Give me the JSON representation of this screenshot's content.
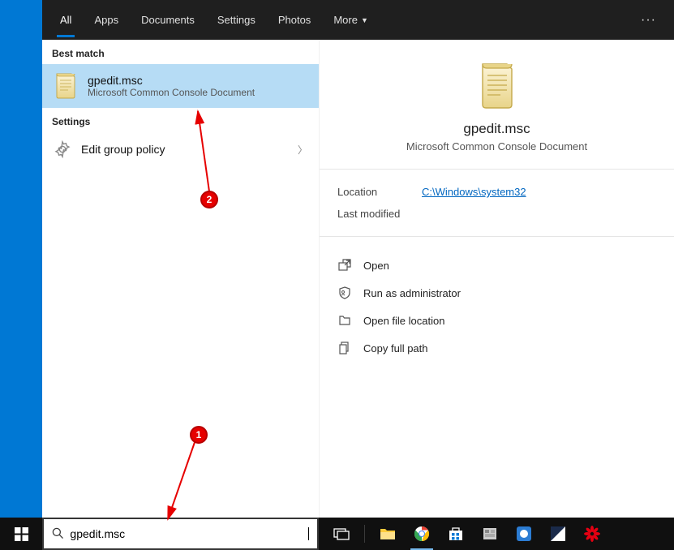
{
  "tabs": {
    "all": "All",
    "apps": "Apps",
    "documents": "Documents",
    "settings": "Settings",
    "photos": "Photos",
    "more": "More"
  },
  "sections": {
    "best_match": "Best match",
    "settings": "Settings"
  },
  "best_match": {
    "title": "gpedit.msc",
    "subtitle": "Microsoft Common Console Document"
  },
  "settings_results": {
    "edit_group_policy": "Edit group policy"
  },
  "preview": {
    "name": "gpedit.msc",
    "type": "Microsoft Common Console Document",
    "location_label": "Location",
    "location_value": "C:\\Windows\\system32",
    "last_modified_label": "Last modified",
    "last_modified_value": ""
  },
  "actions": {
    "open": "Open",
    "run_as_admin": "Run as administrator",
    "open_location": "Open file location",
    "copy_path": "Copy full path"
  },
  "search": {
    "value": "gpedit.msc"
  },
  "annotations": {
    "badge1": "1",
    "badge2": "2"
  }
}
